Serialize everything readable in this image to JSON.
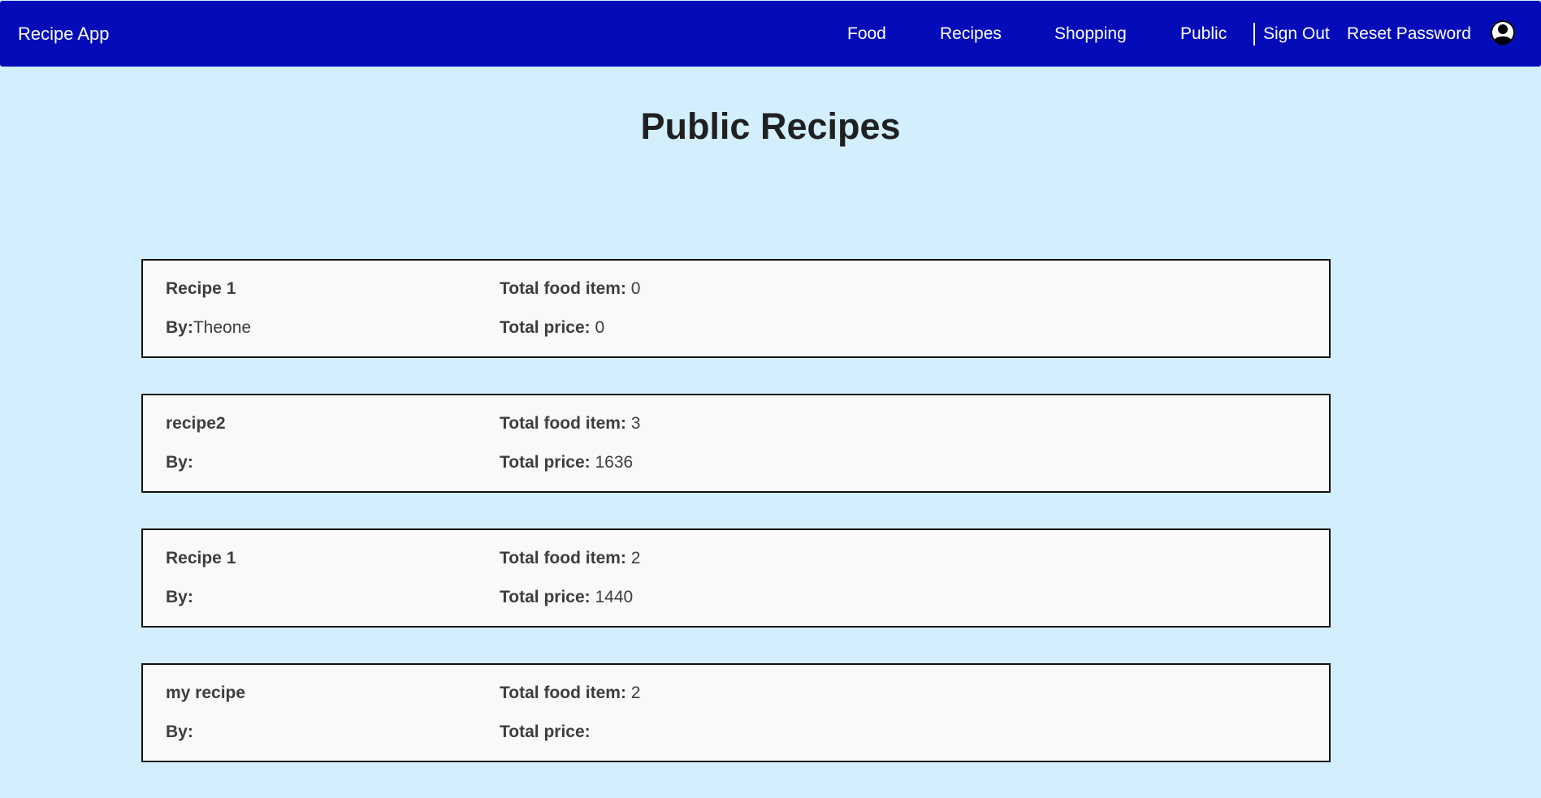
{
  "navbar": {
    "brand": "Recipe App",
    "links": [
      {
        "label": "Food"
      },
      {
        "label": "Recipes"
      },
      {
        "label": "Shopping"
      },
      {
        "label": "Public"
      },
      {
        "label": "Sign Out"
      },
      {
        "label": "Reset Password"
      }
    ],
    "avatar_icon": "user-avatar-icon"
  },
  "main": {
    "title": "Public Recipes"
  },
  "recipe_labels": {
    "by": "By:",
    "total_food_item": "Total food item:",
    "total_price": "Total price:"
  },
  "recipes": [
    {
      "name": "Recipe 1",
      "author": "Theone",
      "total_food_item": "0",
      "total_price": "0"
    },
    {
      "name": "recipe2",
      "author": "",
      "total_food_item": "3",
      "total_price": "1636"
    },
    {
      "name": "Recipe 1",
      "author": "",
      "total_food_item": "2",
      "total_price": "1440"
    },
    {
      "name": "my recipe",
      "author": "",
      "total_food_item": "2",
      "total_price": ""
    }
  ],
  "colors": {
    "navbar_bg": "#040cb9",
    "page_bg": "#d3effe",
    "card_bg": "#f9f9f9"
  }
}
